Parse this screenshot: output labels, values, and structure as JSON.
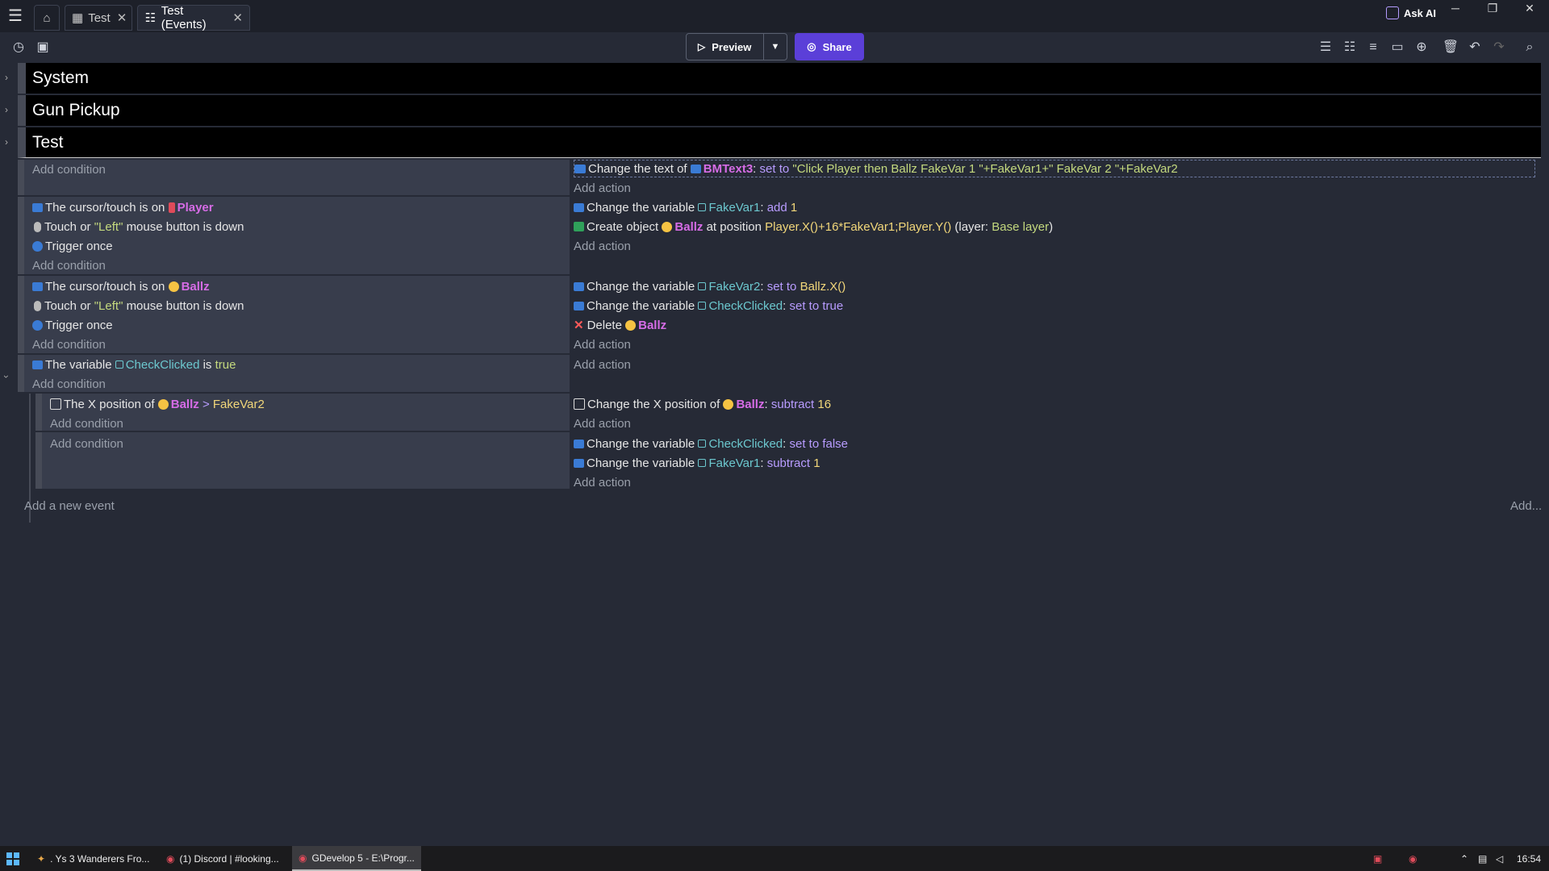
{
  "tabs": [
    {
      "label": "Test",
      "icon": "scene-icon"
    },
    {
      "label": "Test (Events)",
      "icon": "events-icon"
    }
  ],
  "home_icon": "home-icon",
  "ask_ai": "Ask AI",
  "preview_label": "Preview",
  "share_label": "Share",
  "groups": [
    "System",
    "Gun Pickup",
    "Test"
  ],
  "event0": {
    "cond": [
      "Add condition"
    ],
    "actions": {
      "a0": {
        "prefix": "Change the text of",
        "obj": "BMText3",
        "sep": ":",
        "op": "set to",
        "value": "\"Click Player then Ballz FakeVar 1 \"+FakeVar1+\" FakeVar 2 \"+FakeVar2"
      },
      "add": "Add action"
    }
  },
  "event1": {
    "c0": {
      "t": "The cursor/touch is on",
      "obj": "Player"
    },
    "c1": {
      "a": "Touch or",
      "b": "\"Left\"",
      "c": "mouse button is down"
    },
    "c2": "Trigger once",
    "add": "Add condition",
    "a0": {
      "t": "Change the variable",
      "v": "FakeVar1",
      "op": "add",
      "n": "1"
    },
    "a1": {
      "t": "Create object",
      "obj": "Ballz",
      "mid": "at position",
      "expr": "Player.X()+16*FakeVar1;Player.Y()",
      "l1": "(layer:",
      "layer": "Base layer",
      "l2": ")"
    },
    "addA": "Add action"
  },
  "event2": {
    "c0": {
      "t": "The cursor/touch is on",
      "obj": "Ballz"
    },
    "c1": {
      "a": "Touch or",
      "b": "\"Left\"",
      "c": "mouse button is down"
    },
    "c2": "Trigger once",
    "add": "Add condition",
    "a0": {
      "t": "Change the variable",
      "v": "FakeVar2",
      "op": "set to",
      "expr": "Ballz.X()"
    },
    "a1": {
      "t": "Change the variable",
      "v": "CheckClicked",
      "op": "set to",
      "val": "true"
    },
    "a2": {
      "t": "Delete",
      "obj": "Ballz"
    },
    "addA": "Add action"
  },
  "event3": {
    "c0": {
      "t": "The variable",
      "v": "CheckClicked",
      "is": "is",
      "val": "true"
    },
    "add": "Add condition",
    "addA": "Add action"
  },
  "event4": {
    "c0": {
      "t": "The X position of",
      "obj": "Ballz",
      "op": ">",
      "v": "FakeVar2"
    },
    "add": "Add condition",
    "a0": {
      "t": "Change the X position of",
      "obj": "Ballz",
      "op": "subtract",
      "n": "16"
    },
    "addA": "Add action"
  },
  "event5": {
    "add": "Add condition",
    "a0": {
      "t": "Change the variable",
      "v": "CheckClicked",
      "op": "set to",
      "val": "false"
    },
    "a1": {
      "t": "Change the variable",
      "v": "FakeVar1",
      "op": "subtract",
      "n": "1"
    },
    "addA": "Add action"
  },
  "add_event": "Add a new event",
  "add_more": "Add...",
  "taskbar": [
    {
      "label": ". Ys 3 Wanderers Fro..."
    },
    {
      "label": "(1) Discord | #looking..."
    },
    {
      "label": "GDevelop 5 - E:\\Progr..."
    }
  ],
  "clock": "16:54",
  "colors": {
    "accent": "#5b3fd8",
    "object": "#d66ce6",
    "variable": "#6cc8cf",
    "string": "#c4d97e",
    "number": "#f2d77a"
  }
}
